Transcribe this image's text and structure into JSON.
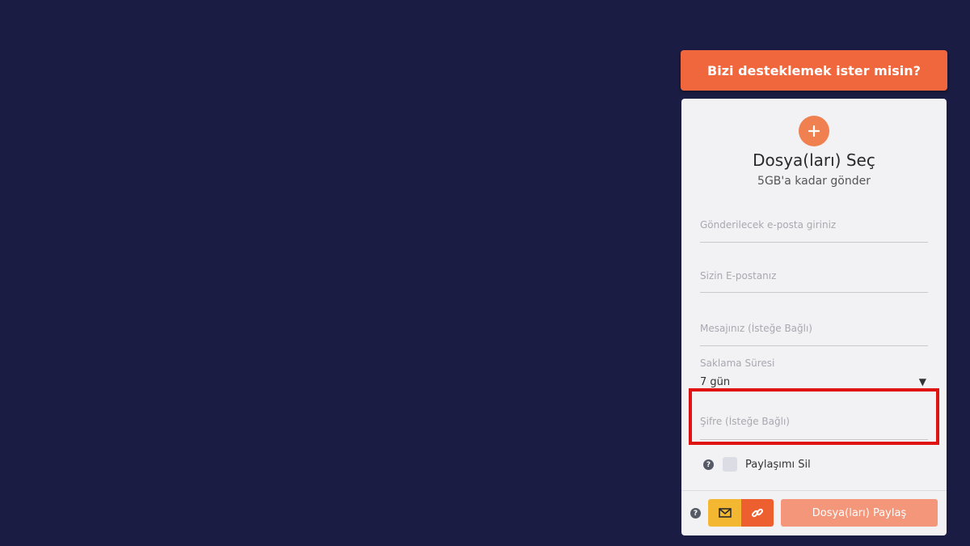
{
  "support_button": {
    "label": "Bizi desteklemek ister misin?"
  },
  "upload": {
    "title": "Dosya(ları) Seç",
    "subtitle": "5GB'a kadar gönder"
  },
  "form": {
    "recipient_placeholder": "Gönderilecek e-posta giriniz",
    "sender_placeholder": "Sizin E-postanız",
    "message_placeholder": "Mesajınız (İsteğe Bağlı)",
    "retention_label": "Saklama Süresi",
    "retention_value": "7 gün",
    "password_placeholder": "Şifre (İsteğe Bağlı)",
    "delete_share_label": "Paylaşımı Sil"
  },
  "footer": {
    "share_label": "Dosya(ları) Paylaş"
  },
  "colors": {
    "background": "#1b1c43",
    "accent": "#f0673e",
    "mail_mode": "#f4b731",
    "link_mode": "#ee5f30",
    "highlight": "#e01313"
  },
  "icons": {
    "add": "plus-icon",
    "help": "question-icon",
    "mail": "envelope-icon",
    "link": "link-icon",
    "dropdown": "caret-down-icon"
  }
}
